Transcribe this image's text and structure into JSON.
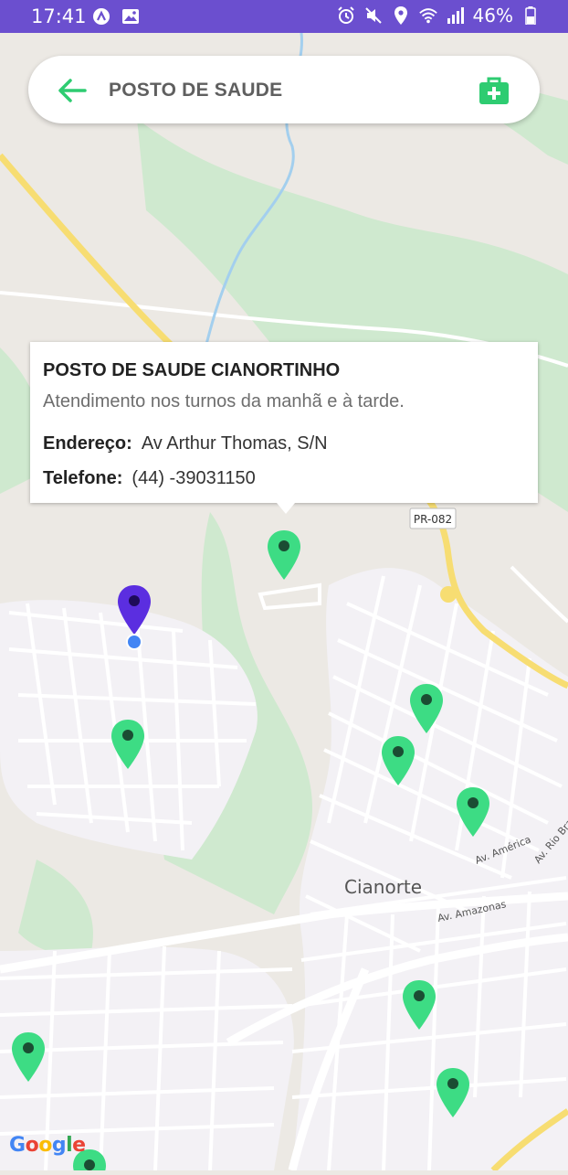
{
  "status_bar": {
    "time": "17:41",
    "battery": "46%"
  },
  "header": {
    "title": "POSTO DE SAUDE",
    "accent_color": "#2ecc71"
  },
  "info_window": {
    "title": "POSTO DE SAUDE CIANORTINHO",
    "description": "Atendimento nos turnos da manhã e à tarde.",
    "address_label": "Endereço:",
    "address_value": "Av Arthur Thomas, S/N",
    "phone_label": "Telefone:",
    "phone_value": "(44) -39031150"
  },
  "map": {
    "city_label": "Cianorte",
    "road_labels": {
      "highway": "PR-082",
      "av_america": "Av. América",
      "av_rio_branco": "Av. Rio Bra",
      "av_amazonas": "Av. Amazonas"
    },
    "attribution": "Google",
    "colors": {
      "health_marker": "#3ddc84",
      "user_marker": "#5b2ee0",
      "user_location_dot": "#4285f4"
    }
  }
}
